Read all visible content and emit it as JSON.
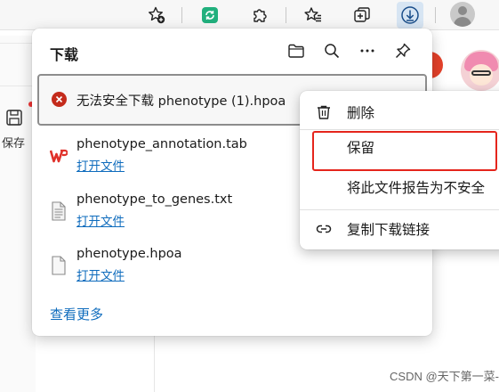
{
  "toolbar": {
    "icons": [
      "favorites-add-icon",
      "sync-icon",
      "extensions-icon",
      "favorites-icon",
      "collections-icon",
      "downloads-icon",
      "profile-icon"
    ],
    "sync_color": "#21b07d",
    "active_highlight": "#d7e5f3"
  },
  "page": {
    "save_label": "保存",
    "watermark": "CSDN @天下第一菜-"
  },
  "downloads": {
    "title": "下载",
    "header_icons": [
      "open-folder-icon",
      "search-icon",
      "more-icon",
      "pin-icon"
    ],
    "failed_item": {
      "text": "无法安全下载 phenotype (1).hpoa",
      "status_color": "#c42b1c"
    },
    "items": [
      {
        "name": "phenotype_annotation.tab",
        "link": "打开文件",
        "icon": "wps-icon"
      },
      {
        "name": "phenotype_to_genes.txt",
        "link": "打开文件",
        "icon": "text-file-icon"
      },
      {
        "name": "phenotype.hpoa",
        "link": "打开文件",
        "icon": "file-icon"
      }
    ],
    "see_more": "查看更多",
    "link_color": "#0f6cbd"
  },
  "context_menu": {
    "items": [
      {
        "label": "删除",
        "icon": "trash-icon"
      },
      {
        "label": "保留",
        "icon": ""
      },
      {
        "label": "将此文件报告为不安全",
        "icon": ""
      },
      {
        "label": "复制下载链接",
        "icon": "link-icon"
      }
    ],
    "highlight_color": "#e5251c"
  }
}
